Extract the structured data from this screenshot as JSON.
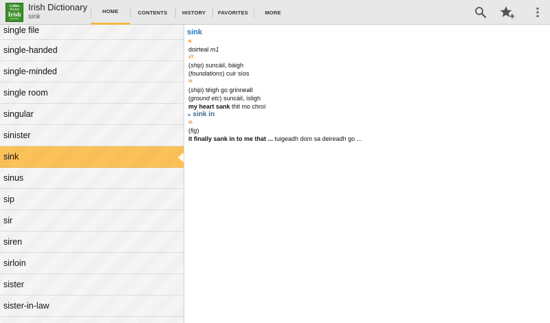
{
  "app": {
    "title": "Irish Dictionary",
    "subtitle": "sink",
    "icon_lines": [
      "Collins",
      "Pocket",
      "Irish",
      "Dictionary"
    ]
  },
  "tabs": [
    {
      "label": "HOME",
      "active": true
    },
    {
      "label": "CONTENTS",
      "active": false
    },
    {
      "label": "HISTORY",
      "active": false
    },
    {
      "label": "FAVORITES",
      "active": false
    },
    {
      "label": "MORE",
      "active": false
    }
  ],
  "actions": {
    "search": "search-icon",
    "favorite_add": "star-plus-icon",
    "overflow": "overflow-menu-icon"
  },
  "wordlist": {
    "items": [
      "single file",
      "single-handed",
      "single-minded",
      "single room",
      "singular",
      "sinister",
      "sink",
      "sinus",
      "sip",
      "sir",
      "siren",
      "sirloin",
      "sister",
      "sister-in-law"
    ],
    "selected": "sink"
  },
  "entry": {
    "headword": "sink",
    "sections": [
      {
        "pos": "N",
        "lines": [
          {
            "pre": "doirteal ",
            "it": "m1",
            "post": ""
          }
        ]
      },
      {
        "pos": "VT",
        "lines": [
          {
            "open": "(",
            "it": "ship",
            "post": ") suncáil, báigh"
          },
          {
            "open": "(",
            "it": "foundations",
            "post": ") cuir síos"
          }
        ]
      },
      {
        "pos": "VI",
        "lines": [
          {
            "open": "(",
            "it": "ship",
            "post": ") téigh go grinneall"
          },
          {
            "open": "(",
            "it": "ground etc",
            "post": ") suncáil, ísligh"
          },
          {
            "bold": "my heart sank",
            "post": " thit mo chroí"
          }
        ]
      }
    ],
    "phrase": {
      "head": "sink in",
      "pos": "VI",
      "lines": [
        {
          "open": "(",
          "it": "fig",
          "post": ")"
        },
        {
          "bold": "it finally sank in to me that ...",
          "post": " tuigeadh dom sa deireadh go ..."
        }
      ]
    }
  },
  "colors": {
    "accent": "#fcc25a",
    "headword": "#2f6fab",
    "pos": "#e5801c"
  }
}
